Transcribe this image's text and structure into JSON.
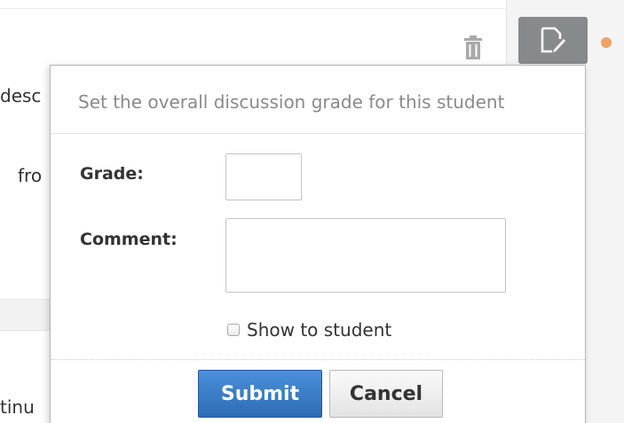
{
  "background": {
    "fragments": [
      "desc",
      "fro",
      "tinu"
    ],
    "icons": {
      "trash": "trash-icon",
      "edit": "edit-document-icon"
    },
    "colors": {
      "edit_button": "#878a8d",
      "status_dot": "#f0a165"
    }
  },
  "popover": {
    "title": "Set the overall discussion grade for this student",
    "grade_label": "Grade:",
    "grade_value": "",
    "comment_label": "Comment:",
    "comment_value": "",
    "show_to_student_label": "Show to student",
    "show_to_student_checked": false,
    "submit_label": "Submit",
    "cancel_label": "Cancel",
    "colors": {
      "submit": "#2d6cb5"
    }
  }
}
